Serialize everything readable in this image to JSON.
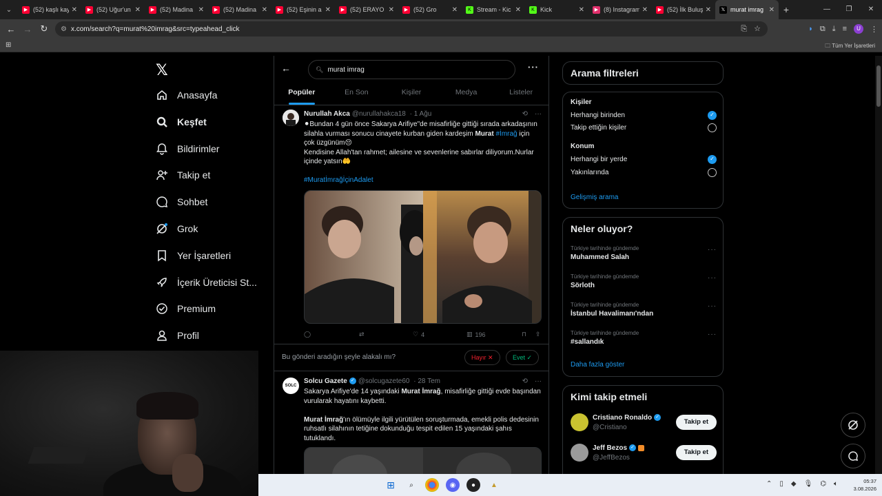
{
  "browser": {
    "tabs": [
      {
        "title": "(52) kaşlı kay",
        "favicon": "youtube-icon",
        "color": "#ff0033"
      },
      {
        "title": "(52) Uğur'un",
        "favicon": "youtube-icon",
        "color": "#ff0033"
      },
      {
        "title": "(52) Madina",
        "favicon": "youtube-icon",
        "color": "#ff0033"
      },
      {
        "title": "(52) Madina",
        "favicon": "youtube-icon",
        "color": "#ff0033"
      },
      {
        "title": "(52) Eşinin a",
        "favicon": "youtube-icon",
        "color": "#ff0033"
      },
      {
        "title": "(52) ERAYO",
        "favicon": "youtube-icon",
        "color": "#ff0033"
      },
      {
        "title": "(52) Gro",
        "favicon": "youtube-icon",
        "color": "#ff0033"
      },
      {
        "title": "Stream - Kic",
        "favicon": "kick-icon",
        "color": "#53fc18"
      },
      {
        "title": "Kick",
        "favicon": "kick-icon",
        "color": "#53fc18"
      },
      {
        "title": "(8) Instagram",
        "favicon": "instagram-icon",
        "color": "#e1306c"
      },
      {
        "title": "(52) İlk Buluş",
        "favicon": "youtube-icon",
        "color": "#ff0033"
      },
      {
        "title": "murat imrag",
        "favicon": "x-icon",
        "color": "#000000",
        "active": true
      }
    ],
    "url": "x.com/search?q=murat%20imrag&src=typeahead_click",
    "bookmarks_all": "Tüm Yer İşaretleri",
    "profile_initial": "U"
  },
  "nav": {
    "items": [
      {
        "label": "Anasayfa",
        "icon": "home-icon"
      },
      {
        "label": "Keşfet",
        "icon": "search-icon"
      },
      {
        "label": "Bildirimler",
        "icon": "bell-icon"
      },
      {
        "label": "Takip et",
        "icon": "add-user-icon"
      },
      {
        "label": "Sohbet",
        "icon": "chat-icon"
      },
      {
        "label": "Grok",
        "icon": "grok-icon"
      },
      {
        "label": "Yer İşaretleri",
        "icon": "bookmark-icon"
      },
      {
        "label": "İçerik Üreticisi St...",
        "icon": "rocket-icon"
      },
      {
        "label": "Premium",
        "icon": "premium-icon"
      },
      {
        "label": "Profil",
        "icon": "profile-icon"
      }
    ]
  },
  "search": {
    "query": "murat imrag",
    "tabs": [
      "Popüler",
      "En Son",
      "Kişiler",
      "Medya",
      "Listeler"
    ]
  },
  "tweet1": {
    "name": "Nurullah Akca",
    "handle": "@nurullahakca18",
    "time": "· 1 Ağu",
    "line1": "⚫Bundan 4 gün önce Sakarya Arifiye\"de misafirliğe gittiği sırada arkadaşının silahla vurması sonucu cinayete kurban giden kardeşim ",
    "bold1": "Murat",
    "hashtag1": "#İmrağ",
    "line2": " için çok üzgünüm😔",
    "line3": "Kendisine Allah'tan rahmet; ailesine ve sevenlerine sabırlar diliyorum.Nurlar içinde yatsın🤲",
    "hashtag2": "#MuratİmrağİçinAdalet",
    "likes": "4",
    "views": "196"
  },
  "relevance": {
    "question": "Bu gönderi aradığın şeyle alakalı mı?",
    "no": "Hayır ✕",
    "yes": "Evet ✓"
  },
  "tweet2": {
    "name": "Solcu Gazete",
    "handle": "@solcugazete60",
    "time": "· 28 Tem",
    "avatar_text": "SOLC",
    "p1a": "Sakarya Arifiye'de 14 yaşındaki ",
    "p1b": "Murat İmrağ",
    "p1c": ", misafirliğe gittiği evde başından vurularak hayatını kaybetti.",
    "p2a": "Murat İmrağ",
    "p2b": "'ın ölümüyle ilgili yürütülen soruşturmada, emekli polis dedesinin ruhsatlı silahının tetiğine dokunduğu tespit edilen 15 yaşındaki şahıs tutuklandı."
  },
  "filters": {
    "title": "Arama filtreleri",
    "people_title": "Kişiler",
    "people_opts": [
      "Herhangi birinden",
      "Takip ettiğin kişiler"
    ],
    "location_title": "Konum",
    "location_opts": [
      "Herhangi bir yerde",
      "Yakınlarında"
    ],
    "advanced": "Gelişmiş arama"
  },
  "trends": {
    "title": "Neler oluyor?",
    "items": [
      {
        "category": "Türkiye tarihinde gündemde",
        "name": "Muhammed Salah"
      },
      {
        "category": "Türkiye tarihinde gündemde",
        "name": "Sörloth"
      },
      {
        "category": "Türkiye tarihinde gündemde",
        "name": "İstanbul Havalimanı'ndan"
      },
      {
        "category": "Türkiye tarihinde gündemde",
        "name": "#sallandık"
      }
    ],
    "show_more": "Daha fazla göster"
  },
  "who": {
    "title": "Kimi takip etmeli",
    "follow_label": "Takip et",
    "accounts": [
      {
        "name": "Cristiano Ronaldo",
        "handle": "@Cristiano"
      },
      {
        "name": "Jeff Bezos",
        "handle": "@JeffBezos"
      }
    ]
  },
  "taskbar": {
    "time": "05:37",
    "date": "3.08.2026"
  },
  "colors": {
    "accent": "#1d9bf0",
    "background": "#000000",
    "border": "#2f3336"
  }
}
